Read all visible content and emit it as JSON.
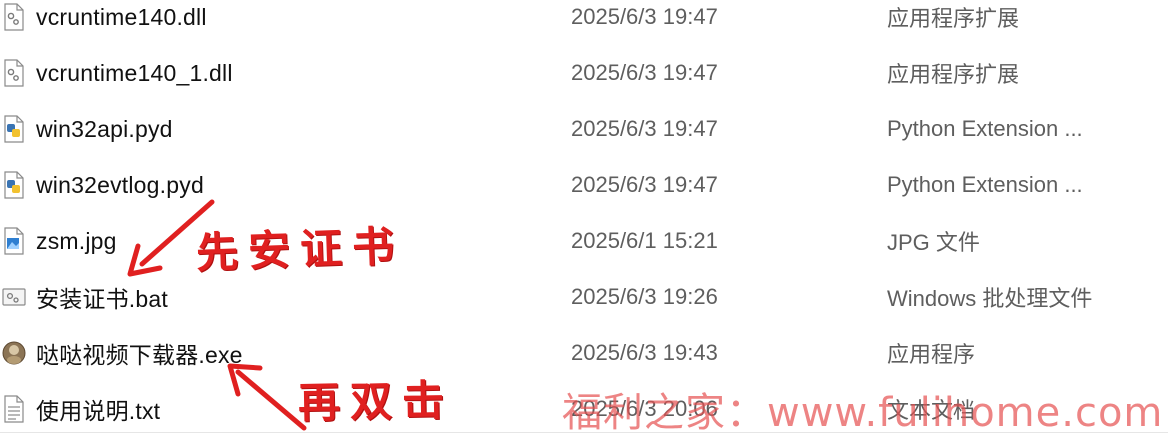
{
  "files": [
    {
      "name": "vcruntime140.dll",
      "date": "2025/6/3 19:47",
      "type": "应用程序扩展",
      "icon": "dll-icon"
    },
    {
      "name": "vcruntime140_1.dll",
      "date": "2025/6/3 19:47",
      "type": "应用程序扩展",
      "icon": "dll-icon"
    },
    {
      "name": "win32api.pyd",
      "date": "2025/6/3 19:47",
      "type": "Python Extension ...",
      "icon": "python-extension-icon"
    },
    {
      "name": "win32evtlog.pyd",
      "date": "2025/6/3 19:47",
      "type": "Python Extension ...",
      "icon": "python-extension-icon"
    },
    {
      "name": "zsm.jpg",
      "date": "2025/6/1 15:21",
      "type": "JPG 文件",
      "icon": "image-file-icon"
    },
    {
      "name": "安装证书.bat",
      "date": "2025/6/3 19:26",
      "type": "Windows 批处理文件",
      "icon": "batch-file-icon"
    },
    {
      "name": "哒哒视频下载器.exe",
      "date": "2025/6/3 19:43",
      "type": "应用程序",
      "icon": "app-exe-icon"
    },
    {
      "name": "使用说明.txt",
      "date": "2025/6/3 20:06",
      "type": "文本文档",
      "icon": "text-file-icon"
    }
  ],
  "annotations": {
    "first": "先安证书",
    "second": "再双击"
  },
  "watermark": "福利之家：www.fulihome.com",
  "colors": {
    "annotation": "#e02020",
    "watermark": "#e65050",
    "secondary_text": "#5e5e5e"
  }
}
